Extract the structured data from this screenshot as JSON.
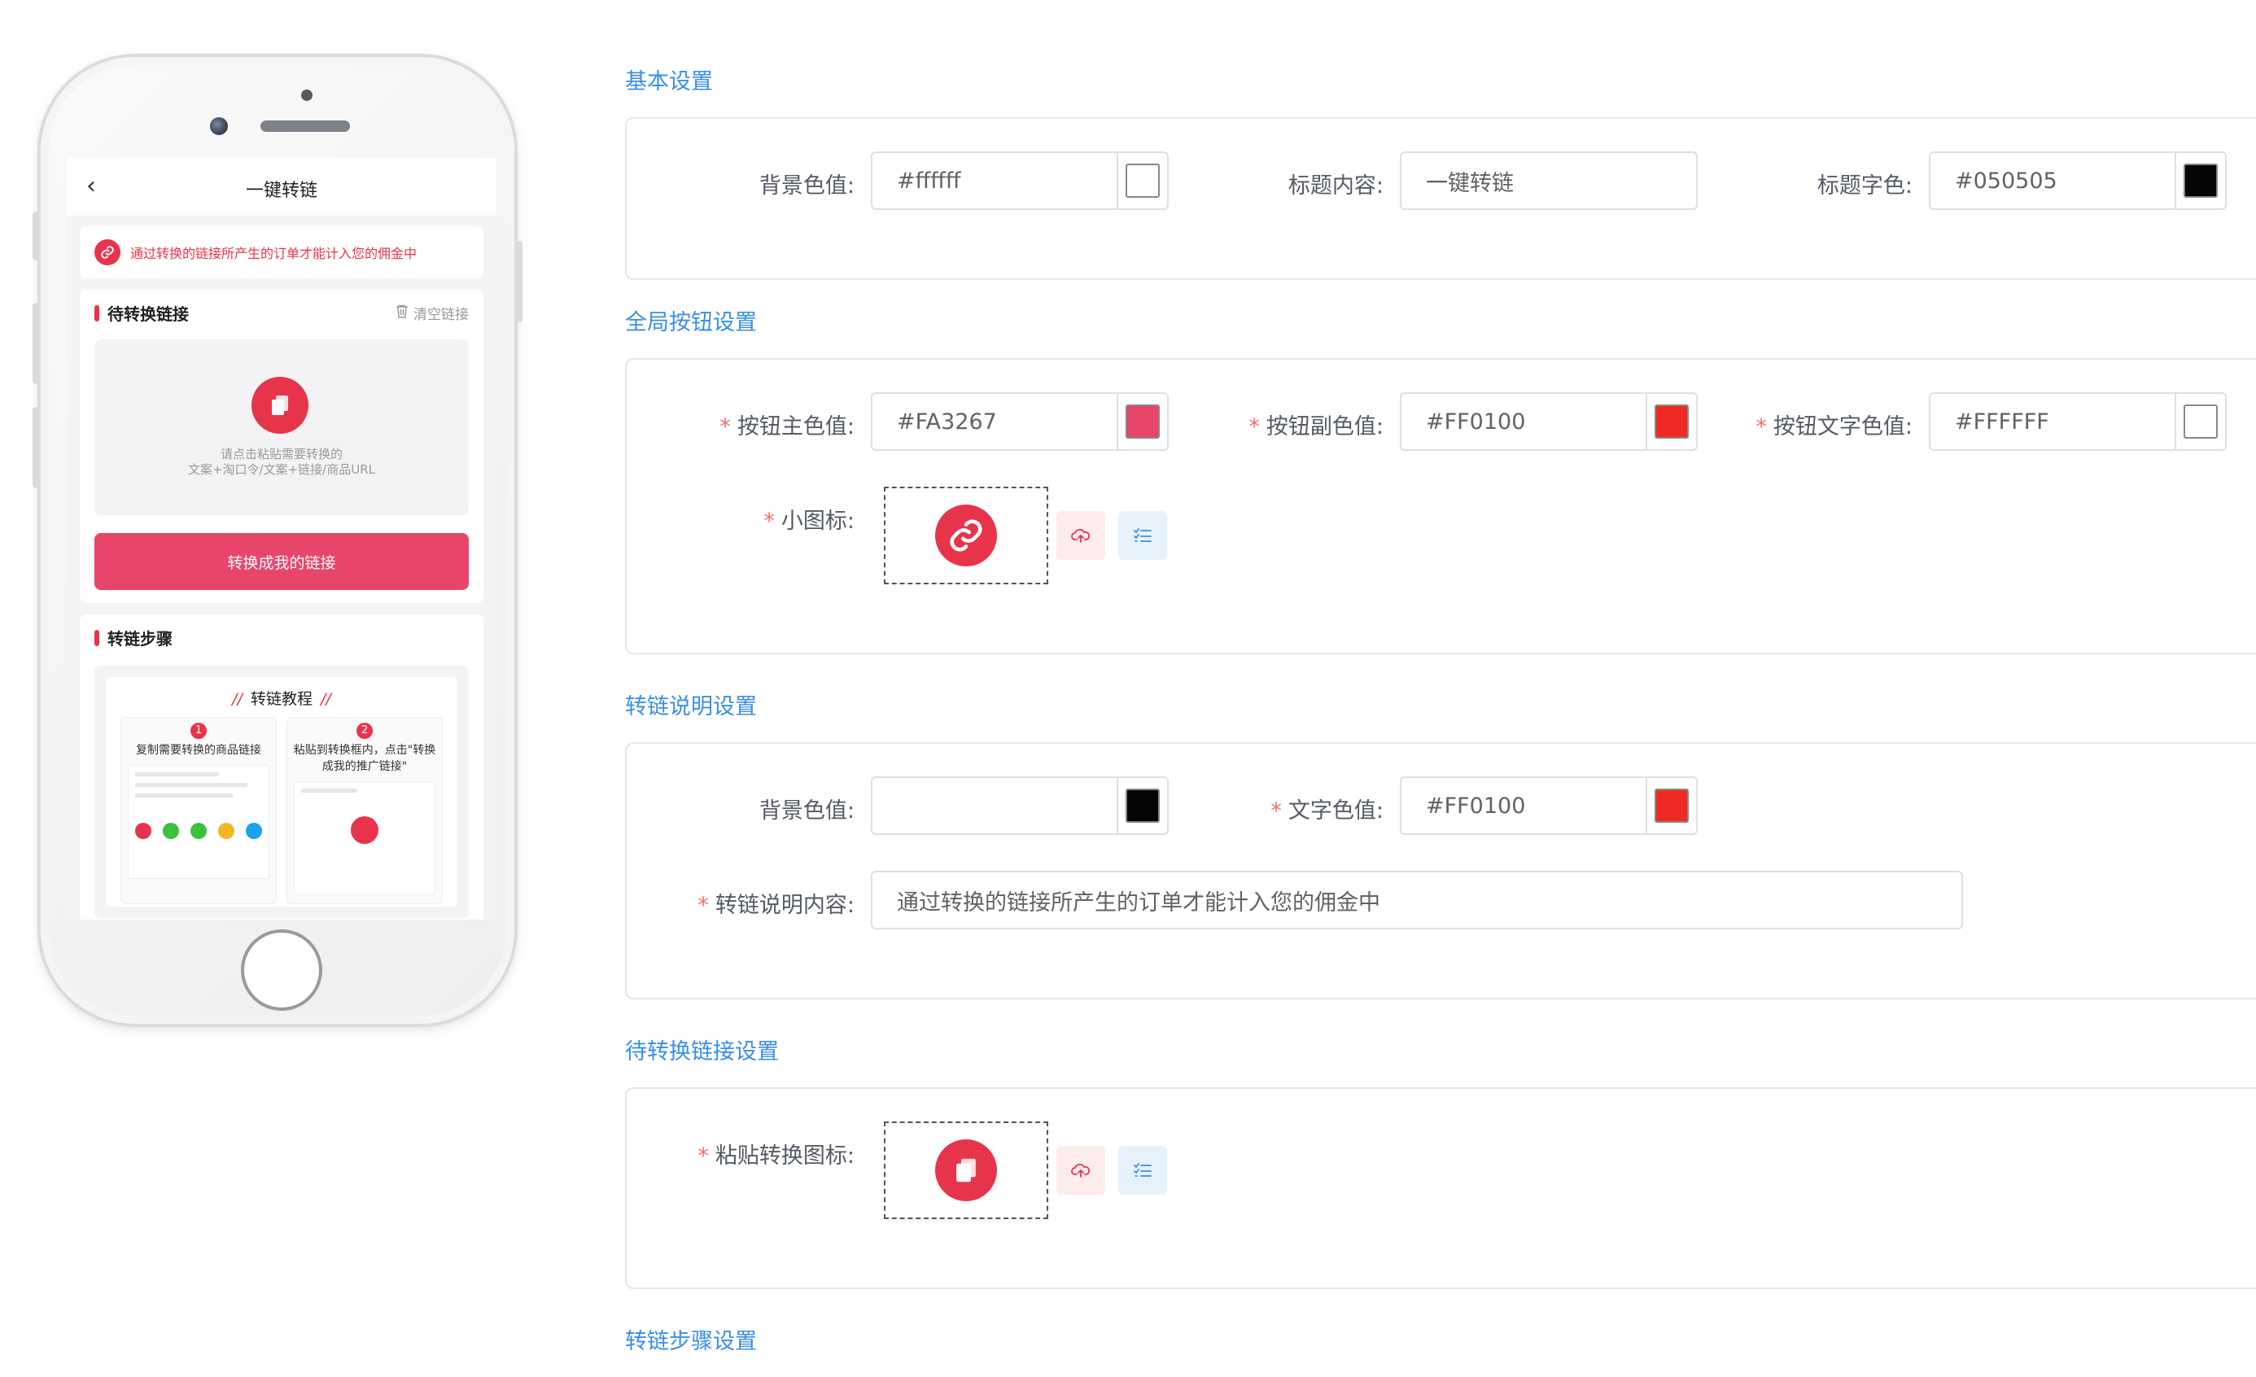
{
  "phone": {
    "back_icon": "chevron-left-icon",
    "title": "一键转链",
    "notice": {
      "icon": "link-icon",
      "text": "通过转换的链接所产生的订单才能计入您的佣金中"
    },
    "pending_card": {
      "title": "待转换链接",
      "clear_label": "清空链接",
      "paste_text_line1": "请点击粘贴需要转换的",
      "paste_text_line2": "文案+淘口令/文案+链接/商品URL",
      "convert_button": "转换成我的链接"
    },
    "steps_card": {
      "title": "转链步骤",
      "tutorial_title": "转链教程",
      "tutorial_slash": "//",
      "step1_num": "1",
      "step1_text": "复制需要转换的商品链接",
      "step2_num": "2",
      "step2_text": "粘贴到转换框内，点击\"转换成我的推广链接\""
    }
  },
  "sections": {
    "basic": {
      "title": "基本设置",
      "bg_color_label": "背景色值:",
      "bg_color_value": "#ffffff",
      "title_content_label": "标题内容:",
      "title_content_value": "一键转链",
      "title_color_label": "标题字色:",
      "title_color_value": "#050505"
    },
    "global_button": {
      "title": "全局按钮设置",
      "primary_label": "按钮主色值:",
      "primary_value": "#FA3267",
      "secondary_label": "按钮副色值:",
      "secondary_value": "#FF0100",
      "text_color_label": "按钮文字色值:",
      "text_color_value": "#FFFFFF",
      "icon_label": "小图标:",
      "required_mark": "*"
    },
    "desc": {
      "title": "转链说明设置",
      "bg_color_label": "背景色值:",
      "bg_color_value": "",
      "text_color_label": "文字色值:",
      "text_color_value": "#FF0100",
      "content_label": "转链说明内容:",
      "content_value": "通过转换的链接所产生的订单才能计入您的佣金中"
    },
    "pending": {
      "title": "待转换链接设置",
      "paste_icon_label": "粘贴转换图标:"
    },
    "steps": {
      "title": "转链步骤设置"
    }
  },
  "colors": {
    "accent_blue": "#3a8ee6",
    "required_red": "#f56c6c",
    "brand_red": "#e8344a",
    "button_pink": "#e8456a",
    "swatch_white": "#ffffff",
    "swatch_black": "#050505",
    "swatch_pink": "#e8466a",
    "swatch_red": "#ee2a22"
  }
}
